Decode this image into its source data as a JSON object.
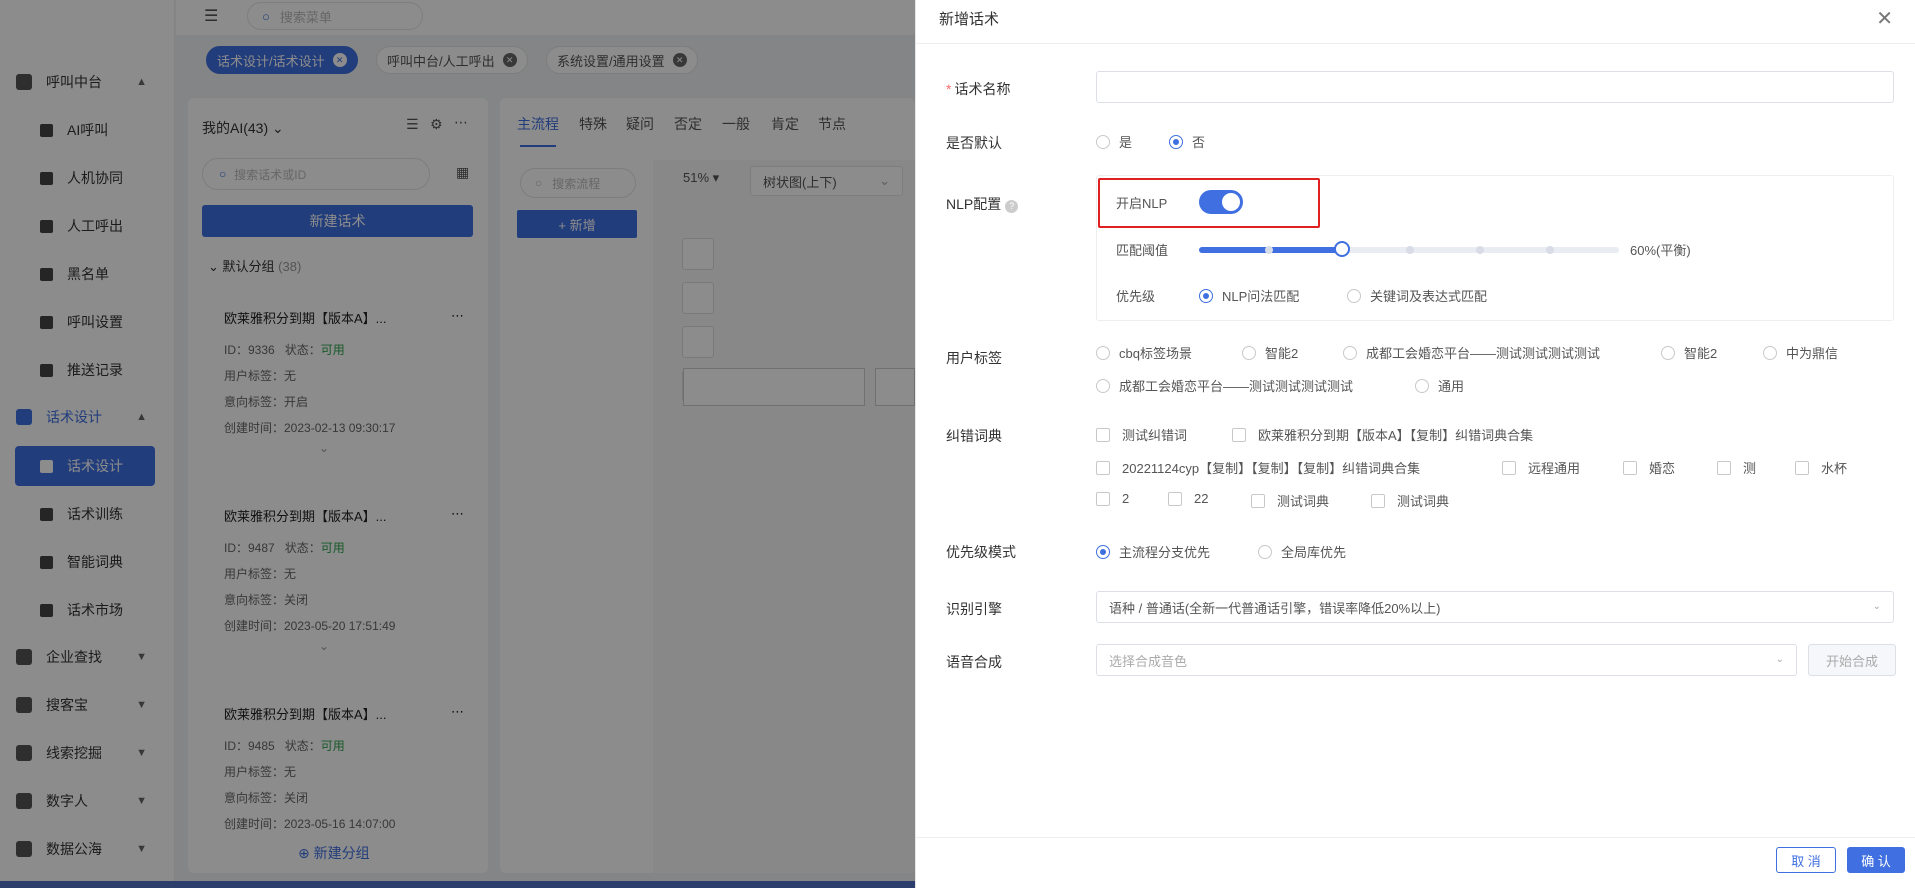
{
  "topbar": {
    "search_placeholder": "搜索菜单"
  },
  "tabs": [
    {
      "label": "话术设计/话术设计"
    },
    {
      "label": "呼叫中台/人工呼出"
    },
    {
      "label": "系统设置/通用设置"
    }
  ],
  "sidebar": {
    "groups": [
      {
        "label": "呼叫中台"
      },
      {
        "label": "话术设计"
      },
      {
        "label": "企业查找"
      },
      {
        "label": "搜客宝"
      },
      {
        "label": "线索挖掘"
      },
      {
        "label": "数字人"
      },
      {
        "label": "数据公海"
      }
    ],
    "call_items": [
      {
        "label": "AI呼叫"
      },
      {
        "label": "人机协同"
      },
      {
        "label": "人工呼出"
      },
      {
        "label": "黑名单"
      },
      {
        "label": "呼叫设置"
      },
      {
        "label": "推送记录"
      }
    ],
    "design_items": [
      {
        "label": "话术设计"
      },
      {
        "label": "话术训练"
      },
      {
        "label": "智能词典"
      },
      {
        "label": "话术市场"
      }
    ]
  },
  "left_panel": {
    "header": "我的AI(43)",
    "search_placeholder": "搜索话术或ID",
    "new_button": "新建话术",
    "group_name": "默认分组",
    "group_count": "(38)",
    "cards": [
      {
        "title": "欧莱雅积分到期【版本A】...",
        "id": "ID：9336",
        "status_label": "状态：",
        "status": "可用",
        "user_tag": "用户标签：无",
        "intent_tag": "意向标签：开启",
        "created": "创建时间：2023-02-13 09:30:17"
      },
      {
        "title": "欧莱雅积分到期【版本A】...",
        "id": "ID：9487",
        "status_label": "状态：",
        "status": "可用",
        "user_tag": "用户标签：无",
        "intent_tag": "意向标签：关闭",
        "created": "创建时间：2023-05-20 17:51:49"
      },
      {
        "title": "欧莱雅积分到期【版本A】...",
        "id": "ID：9485",
        "status_label": "状态：",
        "status": "可用",
        "user_tag": "用户标签：无",
        "intent_tag": "意向标签：关闭",
        "created": "创建时间：2023-05-16 14:07:00"
      }
    ],
    "new_group": "新建分组"
  },
  "mid_panel": {
    "tabs": [
      "主流程",
      "特殊",
      "疑问",
      "否定",
      "一般",
      "肯定",
      "节点"
    ],
    "search_placeholder": "搜索流程",
    "new_button": "+ 新增",
    "zoom": "51%",
    "layout": "树状图(上下)"
  },
  "drawer": {
    "title": "新增话术",
    "name_label": "话术名称",
    "default_label": "是否默认",
    "default_yes": "是",
    "default_no": "否",
    "nlp_label": "NLP配置",
    "nlp_enable": "开启NLP",
    "threshold_label": "匹配阈值",
    "threshold_value": "60%(平衡)",
    "threshold_fraction": 0.6,
    "priority_label": "优先级",
    "priority_opt1": "NLP问法匹配",
    "priority_opt2": "关键词及表达式匹配",
    "user_tag_label": "用户标签",
    "user_tags": [
      "cbq标签场景",
      "智能2",
      "成都工会婚恋平台——测试测试测试测试",
      "智能2",
      "中为鼎信",
      "成都工会婚恋平台——测试测试测试测试",
      "通用"
    ],
    "dict_label": "纠错词典",
    "dicts": [
      "测试纠错词",
      "欧莱雅积分到期【版本A】【复制】纠错词典合集",
      "20221124cyp【复制】【复制】【复制】纠错词典合集",
      "远程通用",
      "婚恋",
      "测",
      "水杯",
      "2",
      "22",
      "测试词典",
      "测试词典"
    ],
    "priority_mode_label": "优先级模式",
    "mode_opt1": "主流程分支优先",
    "mode_opt2": "全局库优先",
    "engine_label": "识别引擎",
    "engine_value": "语种 / 普通话(全新一代普通话引擎，错误率降低20%以上)",
    "tts_label": "语音合成",
    "tts_placeholder": "选择合成音色",
    "tts_start": "开始合成",
    "cancel": "取 消",
    "confirm": "确 认"
  }
}
